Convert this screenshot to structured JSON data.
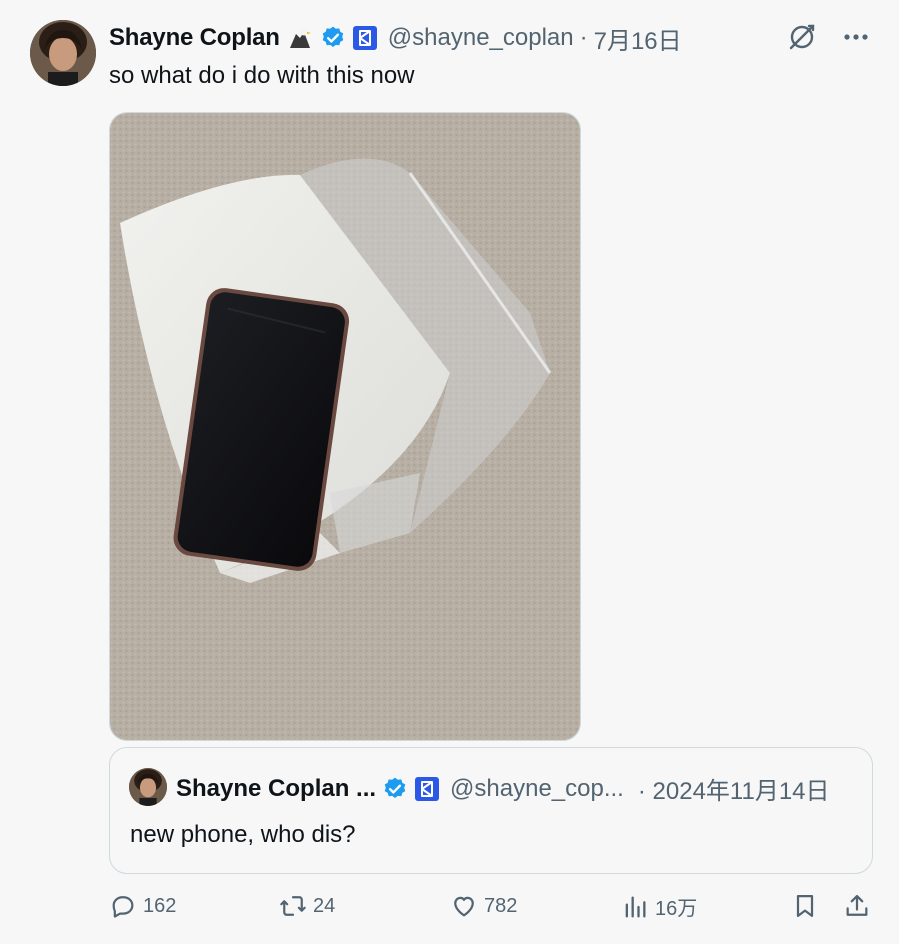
{
  "tweet": {
    "author_name": "Shayne Coplan",
    "author_emoji": "eagle",
    "handle": "@shayne_coplan",
    "separator": "·",
    "date": "7月16日",
    "text": "so what do i do with this now",
    "photo": "phone-on-plastic-bag"
  },
  "quoted": {
    "author_name": "Shayne Coplan ...",
    "handle": "@shayne_cop...",
    "separator": "·",
    "date": "2024年11月14日",
    "text": "new phone, who dis?"
  },
  "actions": {
    "replies": "162",
    "reposts": "24",
    "likes": "782",
    "views": "16万"
  },
  "colors": {
    "background": "#f7f7f8",
    "text": "#0f1419",
    "muted": "#536471",
    "verified": "#1d9bf0",
    "affiliate": "#2b59e6"
  },
  "icons": {
    "grok": "grok-icon",
    "more": "more-icon",
    "reply": "reply-icon",
    "repost": "repost-icon",
    "like": "heart-icon",
    "views": "views-icon",
    "bookmark": "bookmark-icon",
    "share": "share-icon"
  }
}
